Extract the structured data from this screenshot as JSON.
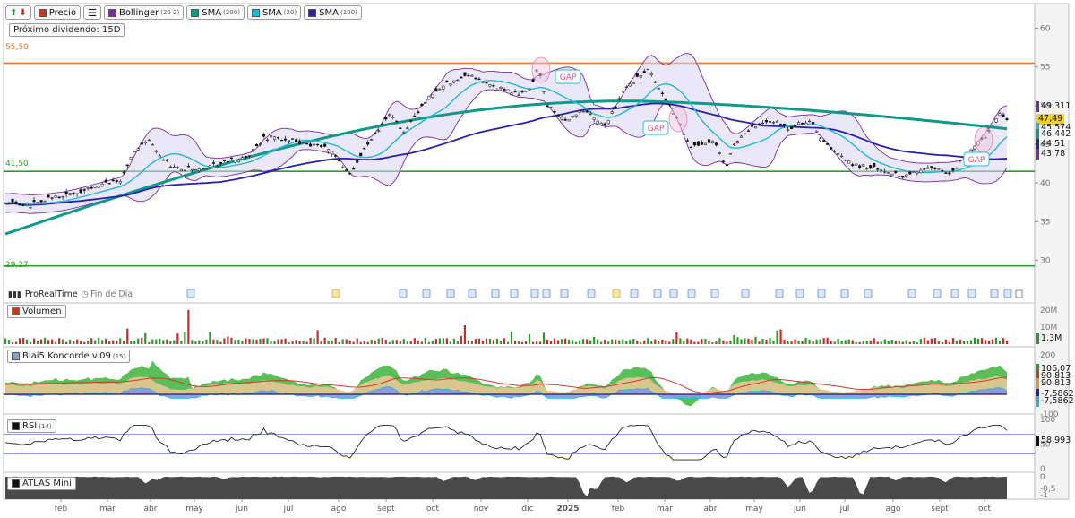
{
  "toolbar": {
    "up_arrow": "arrow-up-icon",
    "down_arrow": "arrow-down-icon",
    "price_label": "Precio",
    "list_icon": "list-icon",
    "indicators": [
      {
        "name": "Bollinger",
        "param": "(20 2)",
        "color": "#7a2aa3"
      },
      {
        "name": "SMA",
        "param": "(200)",
        "color": "#0f9a88"
      },
      {
        "name": "SMA",
        "param": "(20)",
        "color": "#20b8d8"
      },
      {
        "name": "SMA",
        "param": "(100)",
        "color": "#2a1fb0"
      }
    ]
  },
  "dividend_notice": "Próximo dividendo: 15D",
  "price_panel": {
    "ylim": [
      27.5,
      62.5
    ],
    "yticks": [
      "60",
      "55",
      "50",
      "45",
      "40",
      "35",
      "30"
    ],
    "hlines": [
      {
        "value": 55.5,
        "label": "55,50",
        "color": "#f07a30"
      },
      {
        "value": 41.5,
        "label": "41,50",
        "color": "#2aa02a"
      },
      {
        "value": 29.27,
        "label": "29,27",
        "color": "#2aa02a"
      }
    ],
    "gap_labels": [
      "GAP",
      "GAP",
      "GAP"
    ],
    "badges": [
      {
        "text": "49,311",
        "color": "#7a2aa3",
        "value": 49.311
      },
      {
        "text": "47,49",
        "color": "#f2d21a",
        "value": 47.49
      },
      {
        "text": "45,574",
        "color": "#20b8d8",
        "value": 46.0
      },
      {
        "text": "46,442",
        "color": "#0f9a88",
        "value": 46.442
      },
      {
        "text": "44,51",
        "color": "#2a1fb0",
        "value": 44.51
      },
      {
        "text": "43,78",
        "color": "#7a2aa3",
        "value": 43.78
      }
    ]
  },
  "source": {
    "label": "ProRealTime",
    "session": "Fin de Día"
  },
  "volume_panel": {
    "title": "Volumen",
    "yticks": [
      "20M",
      "10M"
    ],
    "badge": "1,3M"
  },
  "koncorde_panel": {
    "title": "Blai5 Koncorde v.09",
    "param": "(15)",
    "yticks": [
      "200",
      "-100"
    ],
    "badges": [
      "106,07",
      "90,813",
      "90,813",
      "-7,5862",
      "-7,5862"
    ]
  },
  "rsi_panel": {
    "title": "RSI",
    "param": "(14)",
    "yticks": [
      "100",
      "50",
      "0"
    ],
    "badge": "58,993",
    "levels": [
      70,
      30
    ]
  },
  "atlas_panel": {
    "title": "ATLAS Mini",
    "yticks": [
      "0",
      "-0,5",
      "-1"
    ]
  },
  "x_axis": {
    "labels": [
      "feb",
      "mar",
      "abr",
      "may",
      "jun",
      "jul",
      "ago",
      "sept",
      "oct",
      "nov",
      "dic",
      "2025",
      "feb",
      "mar",
      "abr",
      "may",
      "jun",
      "jul",
      "ago",
      "sept",
      "oct"
    ]
  },
  "chart_data": {
    "type": "candlestick",
    "title": "",
    "x_range": [
      "2024-01",
      "2025-10"
    ],
    "ylim": [
      27.5,
      62.5
    ],
    "close_keypoints": [
      [
        0,
        37.5
      ],
      [
        25,
        37.0
      ],
      [
        60,
        38.2
      ],
      [
        100,
        39.5
      ],
      [
        130,
        40.5
      ],
      [
        140,
        43.5
      ],
      [
        160,
        45.5
      ],
      [
        185,
        42.0
      ],
      [
        215,
        41.8
      ],
      [
        240,
        42.5
      ],
      [
        270,
        43.5
      ],
      [
        290,
        46.0
      ],
      [
        320,
        45.5
      ],
      [
        360,
        44.5
      ],
      [
        385,
        41.2
      ],
      [
        405,
        45.0
      ],
      [
        430,
        49.0
      ],
      [
        445,
        46.5
      ],
      [
        470,
        51.0
      ],
      [
        495,
        53.0
      ],
      [
        520,
        54.0
      ],
      [
        540,
        52.5
      ],
      [
        575,
        51.5
      ],
      [
        585,
        52.0
      ],
      [
        595,
        55.0
      ],
      [
        605,
        50.0
      ],
      [
        625,
        48.0
      ],
      [
        645,
        49.5
      ],
      [
        670,
        47.5
      ],
      [
        690,
        52.0
      ],
      [
        718,
        54.8
      ],
      [
        730,
        52.0
      ],
      [
        750,
        48.5
      ],
      [
        765,
        44.5
      ],
      [
        790,
        45.5
      ],
      [
        805,
        41.8
      ],
      [
        812,
        45.0
      ],
      [
        835,
        47.5
      ],
      [
        855,
        48.2
      ],
      [
        875,
        47.0
      ],
      [
        900,
        48.0
      ],
      [
        915,
        45.0
      ],
      [
        945,
        42.5
      ],
      [
        975,
        41.8
      ],
      [
        1000,
        40.8
      ],
      [
        1030,
        42.0
      ],
      [
        1055,
        41.2
      ],
      [
        1075,
        44.0
      ],
      [
        1095,
        46.0
      ],
      [
        1108,
        49.0
      ],
      [
        1115,
        48.5
      ],
      [
        1122,
        47.5
      ]
    ],
    "volume_notes": "mostly 1–4M daily, spikes to ~20M early April 2024",
    "rsi_range": [
      20,
      85
    ],
    "last": {
      "close": 47.49,
      "bb_upper": 49.311,
      "bb_lower": 43.78,
      "sma20": 45.574,
      "sma200": 46.442,
      "sma100": 44.51,
      "rsi": 58.993,
      "volume": "1,3M"
    }
  }
}
